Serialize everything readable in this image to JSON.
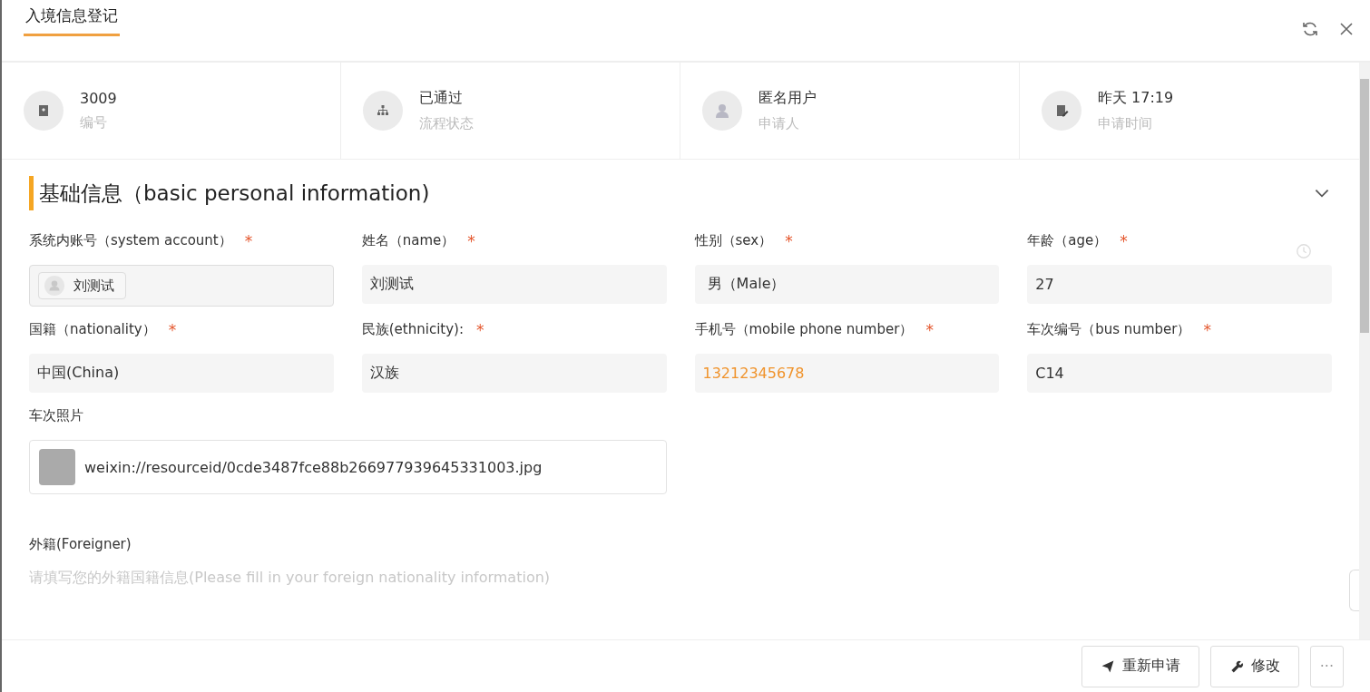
{
  "tabs": [
    {
      "label": "入境信息登记",
      "selected": true
    }
  ],
  "summary": [
    {
      "kind": "number",
      "value": "3009",
      "label": "编号"
    },
    {
      "kind": "flow",
      "value": "已通过",
      "label": "流程状态"
    },
    {
      "kind": "user",
      "value": "匿名用户",
      "label": "申请人"
    },
    {
      "kind": "time",
      "value": "昨天 17:19",
      "label": "申请时间"
    }
  ],
  "section": {
    "title": "基础信息（basic personal information)",
    "expanded": true
  },
  "fields": [
    {
      "kind": "user",
      "label": "系统内账号（system account）",
      "required_mark": "*",
      "value": "刘测试"
    },
    {
      "kind": "text",
      "label": "姓名（name）",
      "required_mark": "*",
      "value": "刘测试"
    },
    {
      "kind": "text",
      "label": "性别（sex）",
      "required_mark": "*",
      "value": " 男（Male）"
    },
    {
      "kind": "text",
      "label": "年龄（age）",
      "required_mark": "*",
      "value": "27"
    },
    {
      "kind": "text",
      "label": "国籍（nationality）",
      "required_mark": "*",
      "value": "中国(China)"
    },
    {
      "kind": "text",
      "label": "民族(ethnicity):",
      "required_mark": "*",
      "value": "汉族"
    },
    {
      "kind": "phone",
      "label": "手机号（mobile phone number）",
      "required_mark": "*",
      "value": "13212345678"
    },
    {
      "kind": "text",
      "label": "车次编号（bus number）",
      "required_mark": "*",
      "value": "C14"
    },
    {
      "kind": "photo",
      "label": "车次照片",
      "value": "weixin://resourceid/0cde3487fce88b266977939645331003.jpg"
    },
    {
      "kind": "empty",
      "label": "外籍(Foreigner)",
      "placeholder": "请填写您的外籍国籍信息(Please fill in your foreign nationality information)"
    }
  ],
  "buttons": [
    {
      "kind": "send",
      "label": "重新申请"
    },
    {
      "kind": "wrench",
      "label": "修改"
    },
    {
      "kind": "more",
      "label": "···"
    }
  ]
}
